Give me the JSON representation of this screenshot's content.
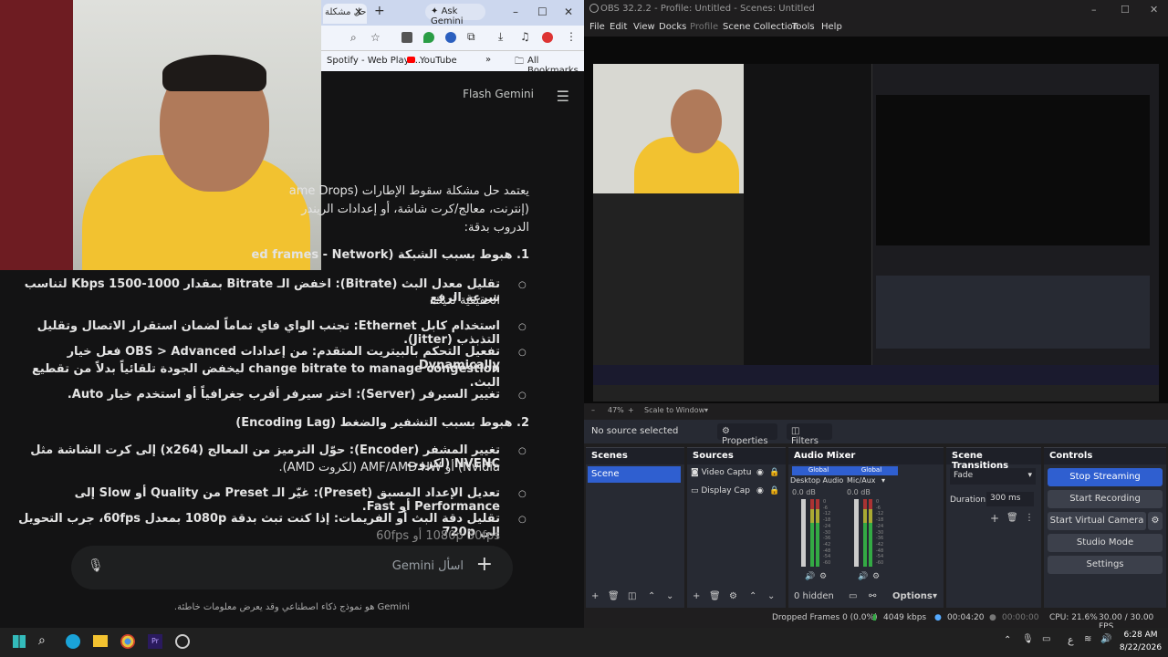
{
  "browser": {
    "tab_title": "حل مشكلة",
    "ask_gemini": "Ask Gemini",
    "bookmarks": [
      "Spotify - Web Playe...",
      "YouTube"
    ],
    "all_bookmarks": "All Bookmarks"
  },
  "gemini": {
    "title": "Flash Gemini",
    "intro_1": "يعتمد حل مشكلة سقوط الإطارات (ame Drops",
    "intro_2": "(إنترنت، معالج/كرت شاشة، أو إعدادات الريندر",
    "intro_3": "الدروب بدقة:",
    "h1": "1. هبوط بسبب الشبكة (ed frames - Network",
    "b1": "تقليل معدل البث (Bitrate): اخفض الـ Bitrate بمقدار 1000-1500 Kbps لتناسب سرعة الرفع",
    "b1b": "الحقيقية لديك.",
    "b2": "استخدام كابل Ethernet: تجنب الواي فاي تماماً لضمان استقرار الاتصال وتقليل التذبذب (Jitter).",
    "b3": "تفعيل التحكم بالبيتريت المتقدم: من إعدادات OBS > Advanced فعل خيار Dynamically",
    "b3b": "change bitrate to manage congestion ليخفض الجودة تلقائياً بدلاً من تقطيع البث.",
    "b4": "تغيير السيرفر (Server): اختر سيرفر أقرب جغرافياً أو استخدم خيار Auto.",
    "h2": "2. هبوط بسبب التشفير والضغط (Encoding Lag)",
    "b5": "تغيير المشفر (Encoder): حوّل الترميز من المعالج (x264) إلى كرت الشاشة مثل NVENC (لكروت",
    "b5b": "Nvidia) أو AMF/AMD HW (لكروت AMD).",
    "b6": "تعديل الإعداد المسبق (Preset): غيّر الـ Preset من Quality أو Slow إلى Performance أو Fast.",
    "b7": "تقليل دقة البث أو الفريمات: إذا كنت تبث بدقة 1080p بمعدل 60fps، جرب التحويل إلى 720p",
    "b7b": "1080p 30fps أو 60fps",
    "placeholder": "اسأل Gemini",
    "disclaimer": "Gemini هو نموذج ذكاء اصطناعي وقد يعرض معلومات خاطئة."
  },
  "obs": {
    "title": "OBS 32.2.2 - Profile: Untitled - Scenes: Untitled",
    "menu": [
      "File",
      "Edit",
      "View",
      "Docks",
      "Profile",
      "Scene Collection",
      "Tools",
      "Help"
    ],
    "zoom": "47%",
    "scale": "Scale to Window",
    "no_source": "No source selected",
    "properties": "Properties",
    "filters": "Filters",
    "scenes_title": "Scenes",
    "scene_item": "Scene",
    "sources_title": "Sources",
    "sources": [
      "Video Captu",
      "Display Cap"
    ],
    "mixer_title": "Audio Mixer",
    "mixer": [
      {
        "label": "Global",
        "name": "Desktop Audio",
        "db": "0.0 dB"
      },
      {
        "label": "Global",
        "name": "Mic/Aux",
        "db": "0.0 dB"
      }
    ],
    "meter_ticks": [
      "0",
      "-6",
      "-12",
      "-18",
      "-24",
      "-30",
      "-36",
      "-42",
      "-48",
      "-54",
      "-60"
    ],
    "hidden": "0 hidden",
    "options": "Options",
    "transitions_title": "Scene Transitions",
    "transition": "Fade",
    "duration_label": "Duration",
    "duration": "300 ms",
    "controls_title": "Controls",
    "controls": [
      "Stop Streaming",
      "Start Recording",
      "Start Virtual Camera",
      "Studio Mode",
      "Settings"
    ],
    "status": {
      "dropped": "Dropped Frames 0 (0.0%)",
      "kbps": "4049 kbps",
      "time1": "00:04:20",
      "time2": "00:00:00",
      "cpu": "CPU: 21.6%",
      "fps": "30.00 / 30.00 FPS"
    }
  },
  "taskbar": {
    "time": "6:28 AM",
    "date": "8/22/2026",
    "lang": "ع"
  },
  "colors": {
    "accent": "#2f5fd0",
    "obs_bg": "#1f1e1f",
    "dock": "#272a33"
  }
}
